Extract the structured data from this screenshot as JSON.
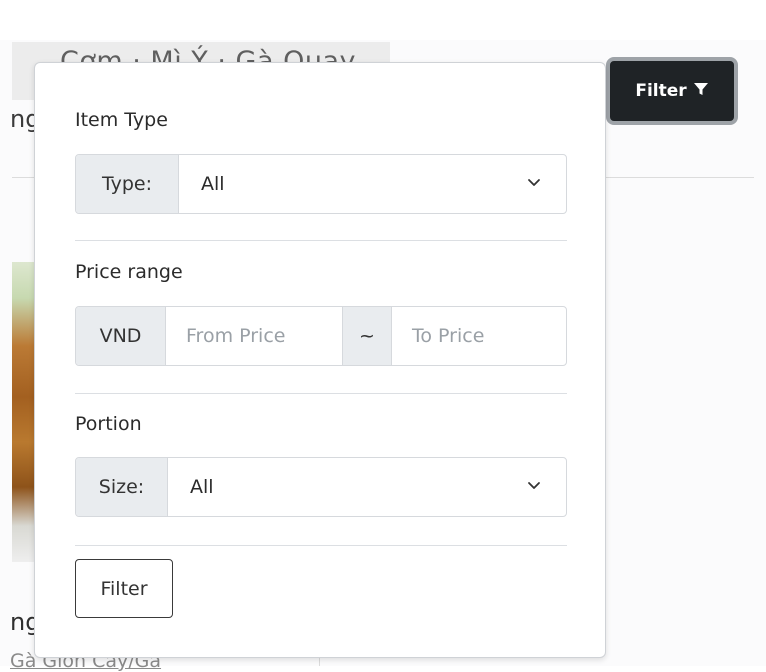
{
  "background": {
    "tabstrip_text": "Cơm · Mì Ý · Gà Quay",
    "left_text_fragment": "ng",
    "card_title_fragment": "ng",
    "card_subtitle_fragment": "Gà Giòn Cay/Gà"
  },
  "filter_toggle": {
    "label": "Filter",
    "icon": "funnel-icon"
  },
  "panel": {
    "item_type": {
      "title": "Item Type",
      "addon": "Type:",
      "value": "All"
    },
    "price_range": {
      "title": "Price range",
      "currency": "VND",
      "from_placeholder": "From Price",
      "separator": "~",
      "to_placeholder": "To Price"
    },
    "portion": {
      "title": "Portion",
      "addon": "Size:",
      "value": "All"
    },
    "submit_label": "Filter"
  },
  "colors": {
    "toggle_bg": "#1f2326",
    "toggle_border": "#9ea3a8",
    "addon_bg": "#e9ecef",
    "placeholder": "#9aa0a6"
  }
}
